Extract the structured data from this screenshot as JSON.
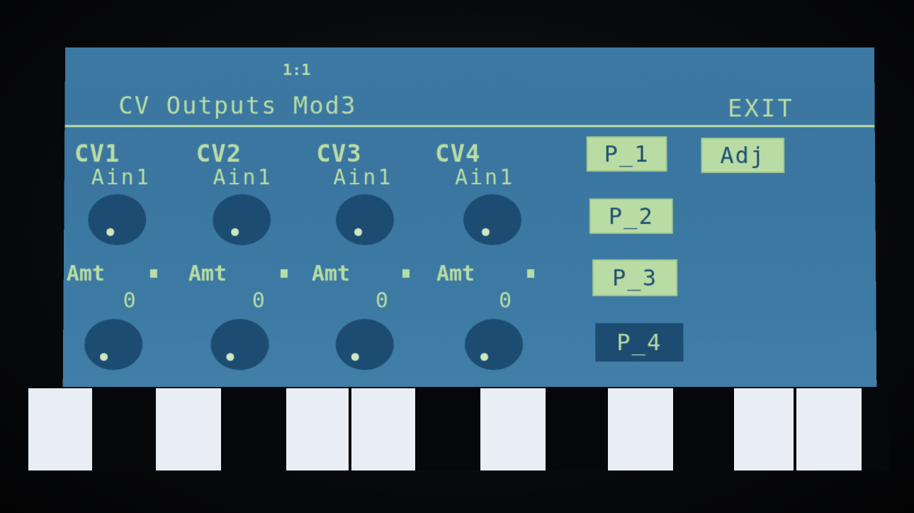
{
  "header": {
    "position": "1:1",
    "title": "CV Outputs Mod3",
    "exit_label": "EXIT"
  },
  "channels": [
    {
      "label": "CV1",
      "source": "Ain1",
      "amt_label": "Amt",
      "amt_value": "0"
    },
    {
      "label": "CV2",
      "source": "Ain1",
      "amt_label": "Amt",
      "amt_value": "0"
    },
    {
      "label": "CV3",
      "source": "Ain1",
      "amt_label": "Amt",
      "amt_value": "0"
    },
    {
      "label": "CV4",
      "source": "Ain1",
      "amt_label": "Amt",
      "amt_value": "0"
    }
  ],
  "pages": [
    {
      "label": "P_1",
      "selected": false
    },
    {
      "label": "P_2",
      "selected": false
    },
    {
      "label": "P_3",
      "selected": false
    },
    {
      "label": "P_4",
      "selected": true
    }
  ],
  "adjust_label": "Adj",
  "colors": {
    "screen_bg": "#3c7aa4",
    "text": "#b8dca4",
    "knob": "#1d4c72",
    "selected_button_bg": "#1d4c72"
  }
}
